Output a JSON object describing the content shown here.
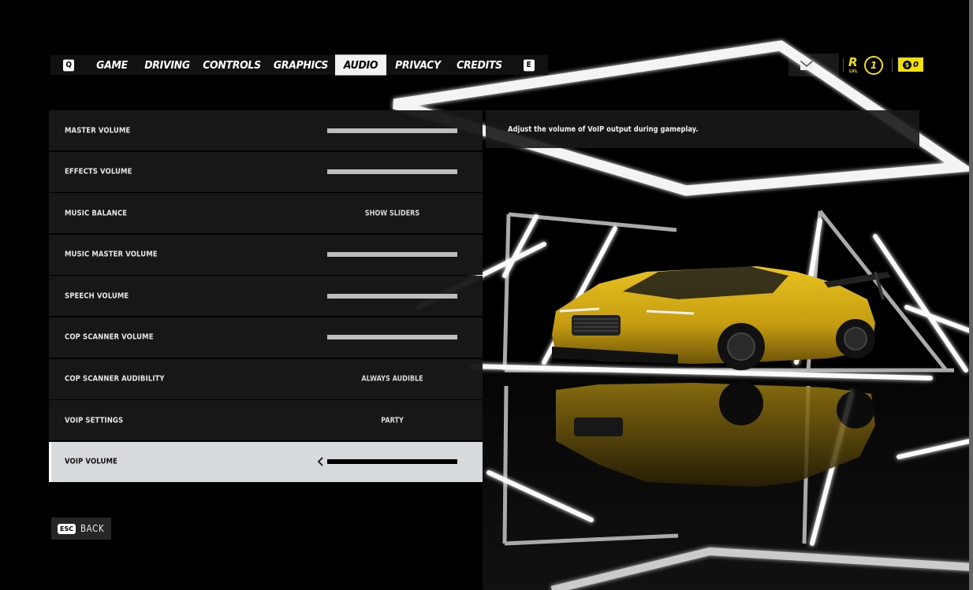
{
  "tabs": [
    {
      "key": "Q"
    },
    {
      "label": "GAME"
    },
    {
      "label": "DRIVING"
    },
    {
      "label": "CONTROLS"
    },
    {
      "label": "GRAPHICS"
    },
    {
      "label": "AUDIO",
      "active": true
    },
    {
      "label": "PRIVACY"
    },
    {
      "label": "CREDITS"
    },
    {
      "key": "E"
    }
  ],
  "status": {
    "rep_letter": "R",
    "rep_sub": "LVL",
    "rep_level": "1",
    "cash_value": "0",
    "accent_color": "#f3e100"
  },
  "settings": [
    {
      "label": "MASTER VOLUME",
      "type": "slider",
      "level": 1.0
    },
    {
      "label": "EFFECTS VOLUME",
      "type": "slider",
      "level": 1.0
    },
    {
      "label": "MUSIC BALANCE",
      "type": "option",
      "value": "SHOW SLIDERS"
    },
    {
      "label": "MUSIC MASTER VOLUME",
      "type": "slider",
      "level": 1.0
    },
    {
      "label": "SPEECH VOLUME",
      "type": "slider",
      "level": 1.0
    },
    {
      "label": "COP SCANNER VOLUME",
      "type": "slider",
      "level": 1.0
    },
    {
      "label": "COP SCANNER AUDIBILITY",
      "type": "option",
      "value": "ALWAYS AUDIBLE"
    },
    {
      "label": "VOIP SETTINGS",
      "type": "option",
      "value": "PARTY"
    },
    {
      "label": "VOIP VOLUME",
      "type": "slider",
      "level": 1.0,
      "selected": true
    }
  ],
  "description": "Adjust the volume of VoIP output during gameplay.",
  "back": {
    "key": "ESC",
    "label": "BACK"
  }
}
